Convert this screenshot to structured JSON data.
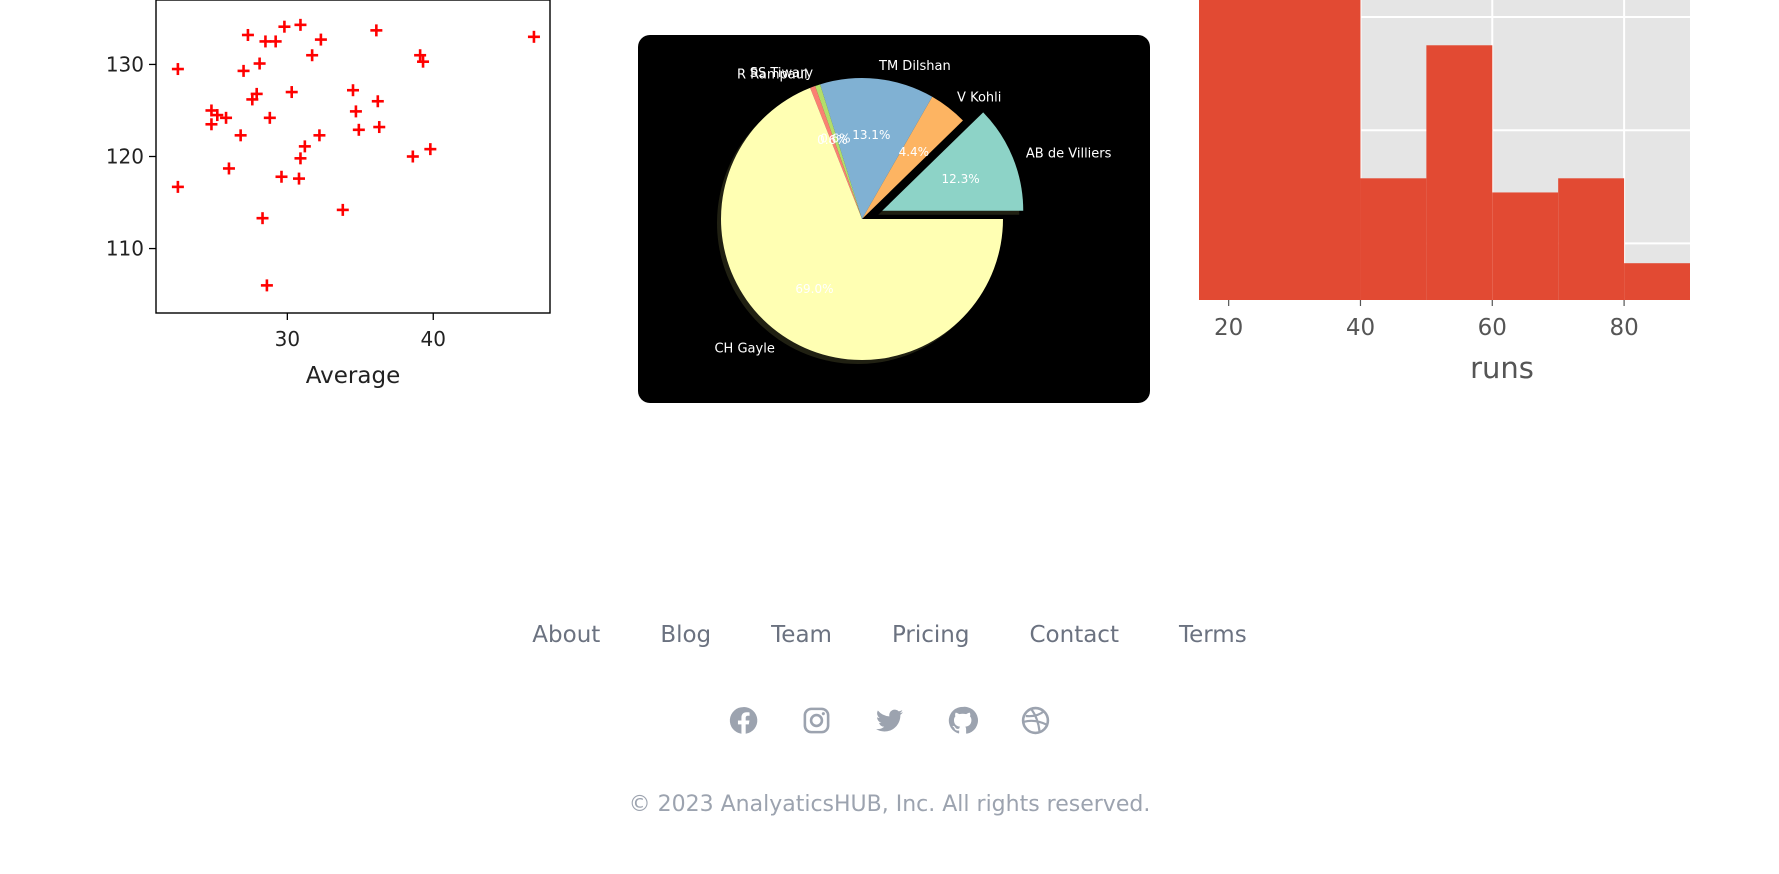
{
  "chart_data": [
    {
      "type": "scatter",
      "xlabel": "Average",
      "xlim": [
        21,
        48
      ],
      "ylim": [
        103,
        137
      ],
      "xticks": [
        30,
        40
      ],
      "yticks": [
        110,
        120,
        130
      ],
      "marker": "plus",
      "color": "#ff0000",
      "points": [
        [
          22.5,
          129.5
        ],
        [
          22.5,
          116.7
        ],
        [
          24.8,
          125.0
        ],
        [
          24.8,
          123.5
        ],
        [
          25.2,
          124.5
        ],
        [
          25.8,
          124.2
        ],
        [
          26.0,
          118.7
        ],
        [
          26.8,
          122.3
        ],
        [
          27.0,
          129.3
        ],
        [
          27.3,
          133.2
        ],
        [
          27.6,
          126.2
        ],
        [
          27.9,
          126.8
        ],
        [
          28.1,
          130.1
        ],
        [
          28.3,
          113.3
        ],
        [
          28.5,
          132.5
        ],
        [
          28.6,
          106.0
        ],
        [
          28.8,
          124.2
        ],
        [
          29.2,
          132.5
        ],
        [
          29.6,
          117.8
        ],
        [
          29.8,
          134.1
        ],
        [
          30.3,
          127.0
        ],
        [
          30.8,
          117.6
        ],
        [
          30.9,
          134.3
        ],
        [
          30.9,
          119.8
        ],
        [
          31.2,
          121.1
        ],
        [
          31.7,
          131.0
        ],
        [
          32.2,
          122.3
        ],
        [
          32.3,
          132.7
        ],
        [
          33.8,
          114.2
        ],
        [
          34.5,
          127.2
        ],
        [
          34.7,
          124.9
        ],
        [
          34.9,
          122.9
        ],
        [
          36.1,
          133.7
        ],
        [
          36.2,
          126.0
        ],
        [
          36.3,
          123.2
        ],
        [
          38.6,
          120.0
        ],
        [
          39.1,
          131.0
        ],
        [
          39.3,
          130.3
        ],
        [
          39.8,
          120.8
        ],
        [
          46.9,
          133.0
        ]
      ]
    },
    {
      "type": "pie",
      "background": "#000000",
      "slices": [
        {
          "label": "AB de Villiers",
          "value": 12.3,
          "pct": "12.3%",
          "color": "#8dd3c7",
          "explode": true
        },
        {
          "label": "V Kohli",
          "value": 4.4,
          "pct": "4.4%",
          "color": "#fdb462",
          "explode": false
        },
        {
          "label": "TM Dilshan",
          "value": 13.1,
          "pct": "13.1%",
          "color": "#80b1d3",
          "explode": false
        },
        {
          "label": "SS Tiwary",
          "value": 0.6,
          "pct": "0.6%",
          "color": "#b3de69",
          "explode": false
        },
        {
          "label": "R Rampaul",
          "value": 0.6,
          "pct": "0.6%",
          "color": "#fb8072",
          "explode": false
        },
        {
          "label": "CH Gayle",
          "value": 69.0,
          "pct": "69.0%",
          "color": "#ffffb3",
          "explode": false
        }
      ]
    },
    {
      "type": "bar",
      "xlabel": "runs",
      "xticks": [
        20,
        40,
        60,
        80
      ],
      "xlim": [
        15.5,
        90
      ],
      "ylim": [
        0,
        10.6
      ],
      "color": "#e24a33",
      "bins": [
        {
          "start": 10,
          "end": 40,
          "value": 11.0
        },
        {
          "start": 40,
          "end": 50,
          "value": 4.3
        },
        {
          "start": 50,
          "end": 60,
          "value": 9.0
        },
        {
          "start": 60,
          "end": 70,
          "value": 3.8
        },
        {
          "start": 70,
          "end": 80,
          "value": 4.3
        },
        {
          "start": 80,
          "end": 90,
          "value": 1.3
        }
      ]
    }
  ],
  "footer": {
    "nav": [
      "About",
      "Blog",
      "Team",
      "Pricing",
      "Contact",
      "Terms"
    ],
    "social": [
      "facebook-icon",
      "instagram-icon",
      "twitter-icon",
      "github-icon",
      "dribbble-icon"
    ],
    "icon_color": "#9ca3af",
    "copyright": "© 2023 AnalyaticsHUB, Inc. All rights reserved."
  }
}
